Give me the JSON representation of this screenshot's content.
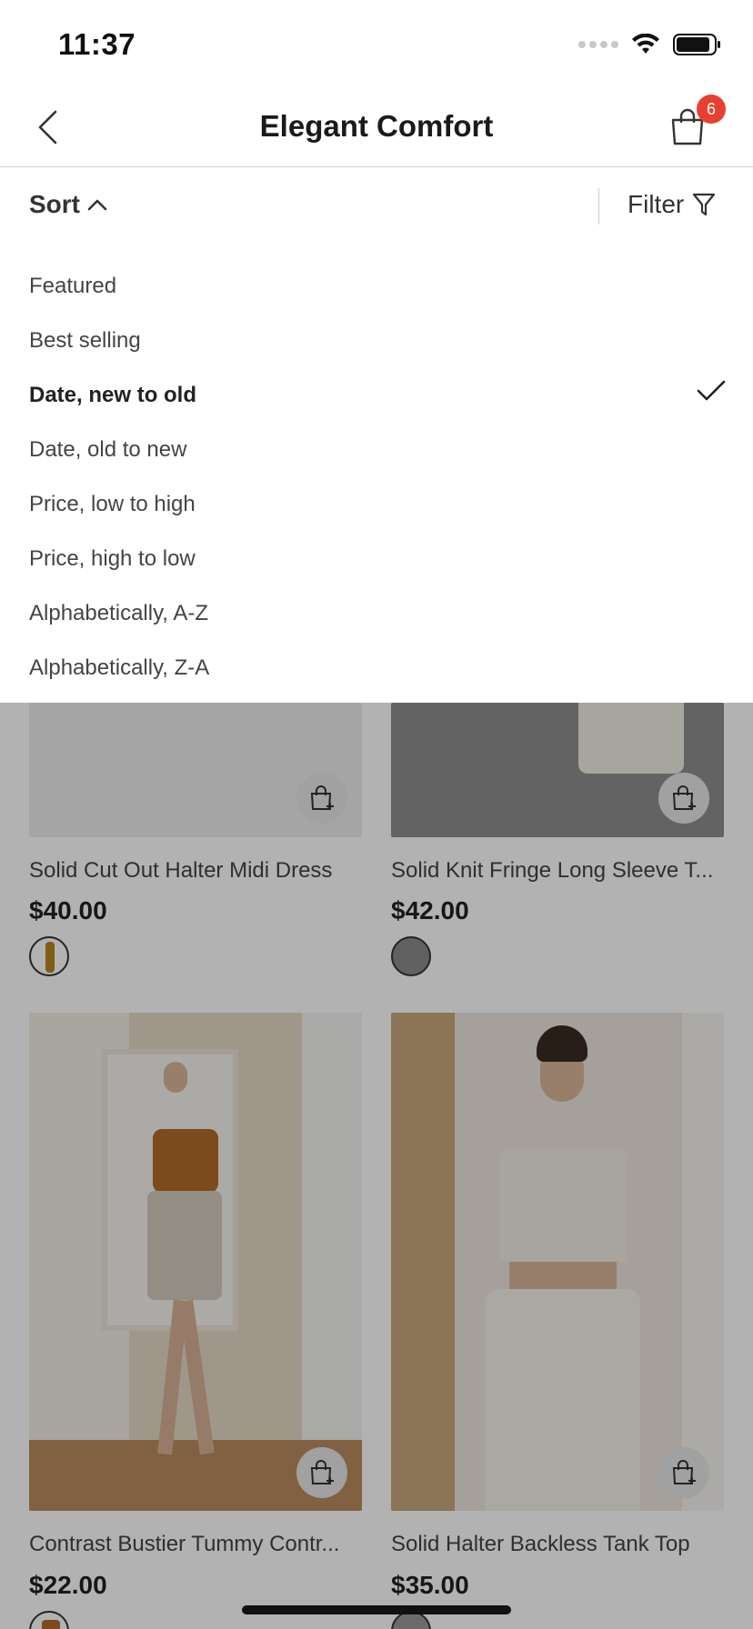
{
  "status_bar": {
    "time": "11:37"
  },
  "header": {
    "title": "Elegant Comfort",
    "cart_count": "6"
  },
  "toolbar": {
    "sort_label": "Sort",
    "filter_label": "Filter"
  },
  "sort_options": [
    {
      "label": "Featured",
      "selected": false
    },
    {
      "label": "Best selling",
      "selected": false
    },
    {
      "label": "Date, new to old",
      "selected": true
    },
    {
      "label": "Date, old to new",
      "selected": false
    },
    {
      "label": "Price, low to high",
      "selected": false
    },
    {
      "label": "Price, high to low",
      "selected": false
    },
    {
      "label": "Alphabetically, A-Z",
      "selected": false
    },
    {
      "label": "Alphabetically, Z-A",
      "selected": false
    }
  ],
  "products": [
    {
      "name": "Solid Cut Out Halter Midi Dress",
      "price": "$40.00",
      "swatch_color": "#b8861f"
    },
    {
      "name": "Solid Knit Fringe Long Sleeve T...",
      "price": "$42.00",
      "swatch_color": "#8c8c8c"
    },
    {
      "name": "Contrast Bustier Tummy Contr...",
      "price": "$22.00",
      "swatch_color": "#b06a2a"
    },
    {
      "name": "Solid Halter Backless Tank Top",
      "price": "$35.00",
      "swatch_color": "#9a9a9a"
    }
  ],
  "colors": {
    "badge": "#e8402f",
    "overlay": "rgba(0,0,0,0.30)"
  }
}
